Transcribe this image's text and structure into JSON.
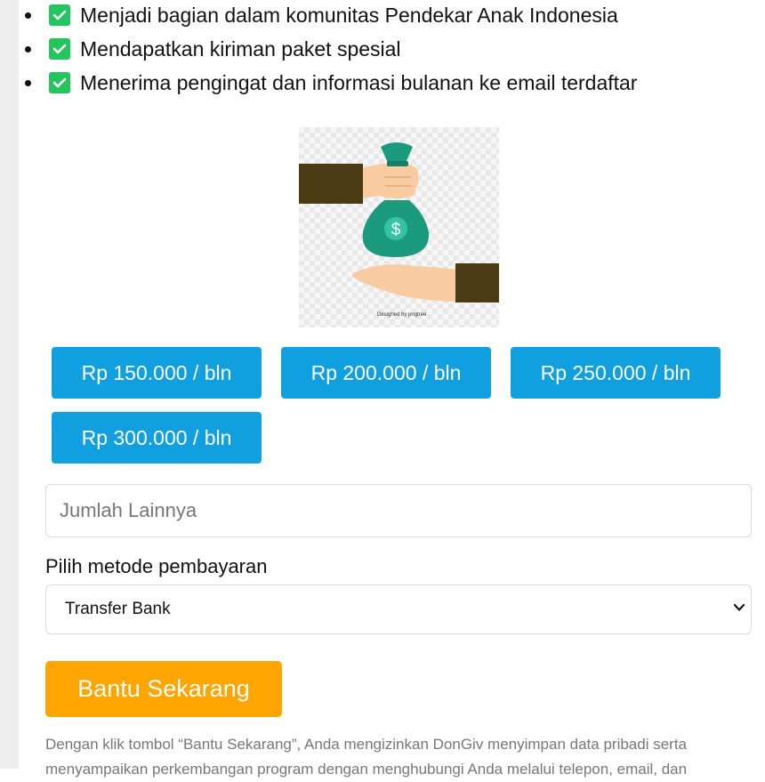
{
  "benefits": [
    "Menjadi bagian dalam komunitas Pendekar Anak Indonesia",
    "Mendapatkan kiriman paket spesial",
    "Menerima pengingat dan informasi bulanan ke email terdaftar"
  ],
  "illustration": {
    "credit": "Designed by pngtree"
  },
  "amounts": [
    "Rp 150.000 / bln",
    "Rp 200.000 / bln",
    "Rp 250.000 / bln",
    "Rp 300.000 / bln"
  ],
  "custom_amount": {
    "placeholder": "Jumlah Lainnya",
    "value": ""
  },
  "payment": {
    "label": "Pilih metode pembayaran",
    "selected": "Transfer Bank"
  },
  "cta": {
    "label": "Bantu Sekarang"
  },
  "disclaimer": "Dengan klik tombol “Bantu Sekarang”, Anda mengizinkan DonGiv menyimpan data pribadi serta menyampaikan perkembangan program dengan menghubungi Anda melalui telepon, email, dan",
  "colors": {
    "check": "#22c55e",
    "amount_button": "#109fdf",
    "cta": "#ffa500",
    "money_bag": "#1c9a7e"
  }
}
